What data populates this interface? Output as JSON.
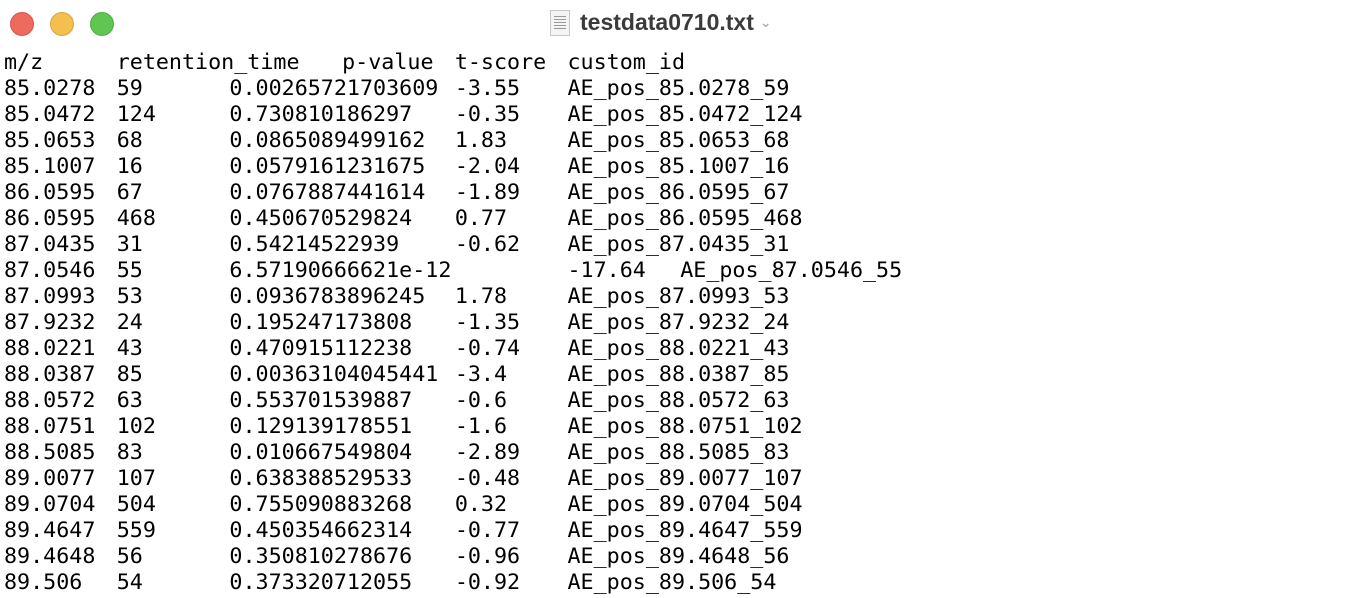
{
  "window": {
    "title": "testdata0710.txt",
    "traffic_lights": {
      "close": "#ec6a5e",
      "minimize": "#f4bf4f",
      "maximize": "#61c554"
    },
    "icons": {
      "document": "document-icon",
      "title_menu": "chevron-down-icon"
    }
  },
  "document": {
    "lines": [
      "m/z\tretention_time\tp-value\tt-score\tcustom_id",
      "85.0278\t59\t0.00265721703609\t-3.55\tAE_pos_85.0278_59",
      "85.0472\t124\t0.730810186297\t-0.35\tAE_pos_85.0472_124",
      "85.0653\t68\t0.0865089499162\t1.83\tAE_pos_85.0653_68",
      "85.1007\t16\t0.0579161231675\t-2.04\tAE_pos_85.1007_16",
      "86.0595\t67\t0.0767887441614\t-1.89\tAE_pos_86.0595_67",
      "86.0595\t468\t0.450670529824\t0.77\tAE_pos_86.0595_468",
      "87.0435\t31\t0.54214522939\t-0.62\tAE_pos_87.0435_31",
      "87.0546\t55\t6.57190666621e-12\t-17.64\tAE_pos_87.0546_55",
      "87.0993\t53\t0.0936783896245\t1.78\tAE_pos_87.0993_53",
      "87.9232\t24\t0.195247173808\t-1.35\tAE_pos_87.9232_24",
      "88.0221\t43\t0.470915112238\t-0.74\tAE_pos_88.0221_43",
      "88.0387\t85\t0.00363104045441\t-3.4\tAE_pos_88.0387_85",
      "88.0572\t63\t0.553701539887\t-0.6\tAE_pos_88.0572_63",
      "88.0751\t102\t0.129139178551\t-1.6\tAE_pos_88.0751_102",
      "88.5085\t83\t0.010667549804\t-2.89\tAE_pos_88.5085_83",
      "89.0077\t107\t0.638388529533\t-0.48\tAE_pos_89.0077_107",
      "89.0704\t504\t0.755090883268\t0.32\tAE_pos_89.0704_504",
      "89.4647\t559\t0.450354662314\t-0.77\tAE_pos_89.4647_559",
      "89.4648\t56\t0.350810278676\t-0.96\tAE_pos_89.4648_56",
      "89.506\t54\t0.373320712055\t-0.92\tAE_pos_89.506_54"
    ]
  }
}
